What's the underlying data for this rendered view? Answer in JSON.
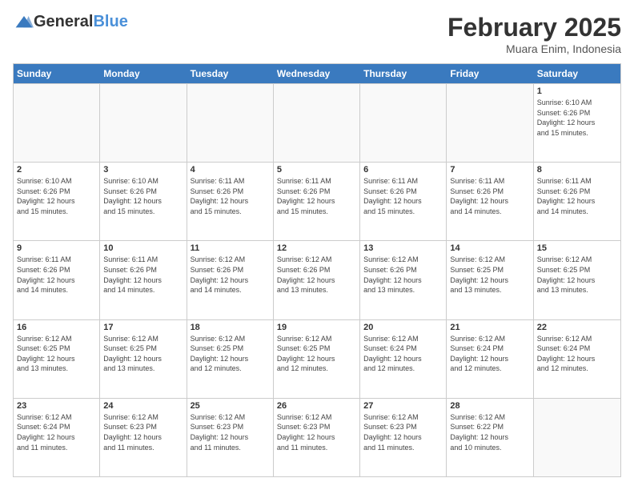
{
  "header": {
    "logo_general": "General",
    "logo_blue": "Blue",
    "month_title": "February 2025",
    "location": "Muara Enim, Indonesia"
  },
  "days_of_week": [
    "Sunday",
    "Monday",
    "Tuesday",
    "Wednesday",
    "Thursday",
    "Friday",
    "Saturday"
  ],
  "weeks": [
    [
      {
        "day": "",
        "info": ""
      },
      {
        "day": "",
        "info": ""
      },
      {
        "day": "",
        "info": ""
      },
      {
        "day": "",
        "info": ""
      },
      {
        "day": "",
        "info": ""
      },
      {
        "day": "",
        "info": ""
      },
      {
        "day": "1",
        "info": "Sunrise: 6:10 AM\nSunset: 6:26 PM\nDaylight: 12 hours\nand 15 minutes."
      }
    ],
    [
      {
        "day": "2",
        "info": "Sunrise: 6:10 AM\nSunset: 6:26 PM\nDaylight: 12 hours\nand 15 minutes."
      },
      {
        "day": "3",
        "info": "Sunrise: 6:10 AM\nSunset: 6:26 PM\nDaylight: 12 hours\nand 15 minutes."
      },
      {
        "day": "4",
        "info": "Sunrise: 6:11 AM\nSunset: 6:26 PM\nDaylight: 12 hours\nand 15 minutes."
      },
      {
        "day": "5",
        "info": "Sunrise: 6:11 AM\nSunset: 6:26 PM\nDaylight: 12 hours\nand 15 minutes."
      },
      {
        "day": "6",
        "info": "Sunrise: 6:11 AM\nSunset: 6:26 PM\nDaylight: 12 hours\nand 15 minutes."
      },
      {
        "day": "7",
        "info": "Sunrise: 6:11 AM\nSunset: 6:26 PM\nDaylight: 12 hours\nand 14 minutes."
      },
      {
        "day": "8",
        "info": "Sunrise: 6:11 AM\nSunset: 6:26 PM\nDaylight: 12 hours\nand 14 minutes."
      }
    ],
    [
      {
        "day": "9",
        "info": "Sunrise: 6:11 AM\nSunset: 6:26 PM\nDaylight: 12 hours\nand 14 minutes."
      },
      {
        "day": "10",
        "info": "Sunrise: 6:11 AM\nSunset: 6:26 PM\nDaylight: 12 hours\nand 14 minutes."
      },
      {
        "day": "11",
        "info": "Sunrise: 6:12 AM\nSunset: 6:26 PM\nDaylight: 12 hours\nand 14 minutes."
      },
      {
        "day": "12",
        "info": "Sunrise: 6:12 AM\nSunset: 6:26 PM\nDaylight: 12 hours\nand 13 minutes."
      },
      {
        "day": "13",
        "info": "Sunrise: 6:12 AM\nSunset: 6:26 PM\nDaylight: 12 hours\nand 13 minutes."
      },
      {
        "day": "14",
        "info": "Sunrise: 6:12 AM\nSunset: 6:25 PM\nDaylight: 12 hours\nand 13 minutes."
      },
      {
        "day": "15",
        "info": "Sunrise: 6:12 AM\nSunset: 6:25 PM\nDaylight: 12 hours\nand 13 minutes."
      }
    ],
    [
      {
        "day": "16",
        "info": "Sunrise: 6:12 AM\nSunset: 6:25 PM\nDaylight: 12 hours\nand 13 minutes."
      },
      {
        "day": "17",
        "info": "Sunrise: 6:12 AM\nSunset: 6:25 PM\nDaylight: 12 hours\nand 13 minutes."
      },
      {
        "day": "18",
        "info": "Sunrise: 6:12 AM\nSunset: 6:25 PM\nDaylight: 12 hours\nand 12 minutes."
      },
      {
        "day": "19",
        "info": "Sunrise: 6:12 AM\nSunset: 6:25 PM\nDaylight: 12 hours\nand 12 minutes."
      },
      {
        "day": "20",
        "info": "Sunrise: 6:12 AM\nSunset: 6:24 PM\nDaylight: 12 hours\nand 12 minutes."
      },
      {
        "day": "21",
        "info": "Sunrise: 6:12 AM\nSunset: 6:24 PM\nDaylight: 12 hours\nand 12 minutes."
      },
      {
        "day": "22",
        "info": "Sunrise: 6:12 AM\nSunset: 6:24 PM\nDaylight: 12 hours\nand 12 minutes."
      }
    ],
    [
      {
        "day": "23",
        "info": "Sunrise: 6:12 AM\nSunset: 6:24 PM\nDaylight: 12 hours\nand 11 minutes."
      },
      {
        "day": "24",
        "info": "Sunrise: 6:12 AM\nSunset: 6:23 PM\nDaylight: 12 hours\nand 11 minutes."
      },
      {
        "day": "25",
        "info": "Sunrise: 6:12 AM\nSunset: 6:23 PM\nDaylight: 12 hours\nand 11 minutes."
      },
      {
        "day": "26",
        "info": "Sunrise: 6:12 AM\nSunset: 6:23 PM\nDaylight: 12 hours\nand 11 minutes."
      },
      {
        "day": "27",
        "info": "Sunrise: 6:12 AM\nSunset: 6:23 PM\nDaylight: 12 hours\nand 11 minutes."
      },
      {
        "day": "28",
        "info": "Sunrise: 6:12 AM\nSunset: 6:22 PM\nDaylight: 12 hours\nand 10 minutes."
      },
      {
        "day": "",
        "info": ""
      }
    ]
  ]
}
